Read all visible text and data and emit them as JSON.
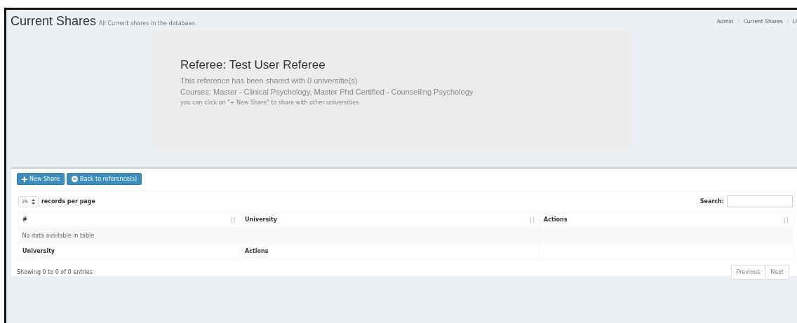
{
  "header": {
    "title": "Current Shares",
    "subtitle": "All Current shares in the database."
  },
  "breadcrumb": [
    "Admin",
    "Current Shares",
    "Li"
  ],
  "referee": {
    "title": "Referee: Test User Referee",
    "lines": [
      "This reference has been shared with 0 universitie(s)",
      "Courses: Master - Clinical Psychology, Master Phd Certified - Counselling Psychology"
    ],
    "note": "you can click on \"+ New Share\" to share with other universities."
  },
  "buttons": [
    {
      "kind": "plus",
      "label": "New Share"
    },
    {
      "kind": "circle",
      "label": "Back to reference(s)"
    }
  ],
  "length": {
    "value": "25",
    "label": "records per page"
  },
  "search": {
    "label": "Search:"
  },
  "table": {
    "columns": [
      "#",
      "University",
      "Actions"
    ],
    "empty": "No data available in table",
    "footer": [
      "University",
      "Actions"
    ]
  },
  "info": "Showing 0 to 0 of 0 entries",
  "pagination": [
    "Previous",
    "Next"
  ]
}
